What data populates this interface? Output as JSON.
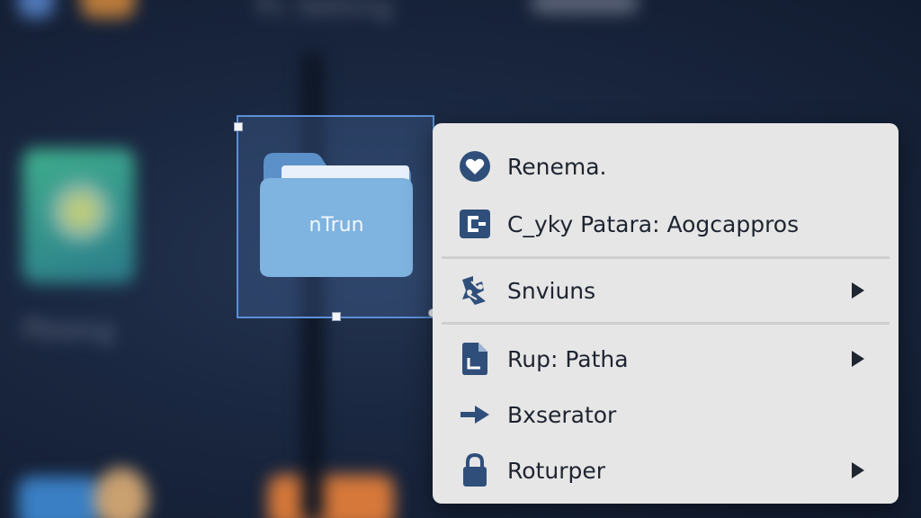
{
  "desktop": {
    "background_labels": [
      "Pc Setting",
      "Pbieng"
    ]
  },
  "folder": {
    "name": "nTrun",
    "colors": {
      "front": "#7fb3e0",
      "back": "#5c90c9",
      "selection_border": "#5b8fd9"
    }
  },
  "context_menu": {
    "items": [
      {
        "label": "Renema.",
        "icon": "heart-icon",
        "has_submenu": false
      },
      {
        "label": "C_yky Patara: Aogcappros",
        "icon": "copy-icon",
        "has_submenu": false
      },
      {
        "label": "Snviuns",
        "icon": "share-network-icon",
        "has_submenu": true
      },
      {
        "label": "Rup: Patha",
        "icon": "document-icon",
        "has_submenu": true
      },
      {
        "label": "Bxserator",
        "icon": "arrow-right-icon",
        "has_submenu": false
      },
      {
        "label": "Roturper",
        "icon": "lock-icon",
        "has_submenu": true
      }
    ],
    "icon_color": "#2f4f7a"
  }
}
